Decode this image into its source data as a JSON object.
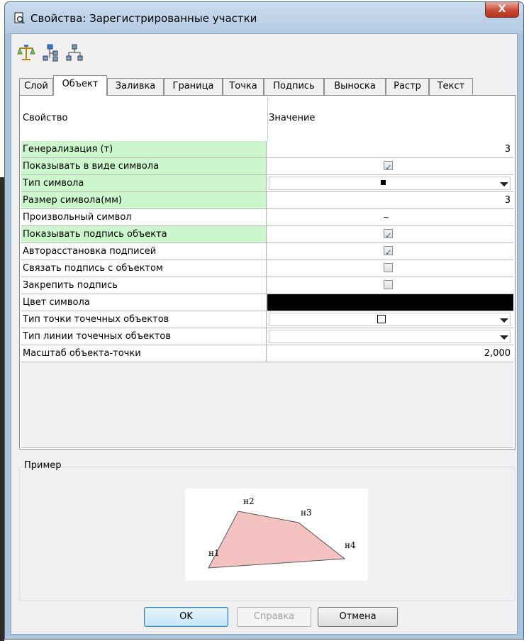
{
  "window": {
    "title": "Свойства: Зарегистрированные участки",
    "close_label": "X"
  },
  "toolbar": {
    "icons": [
      "scales-icon",
      "tree-expand-icon",
      "tree-structure-icon"
    ]
  },
  "tabs": [
    {
      "label": "Слой",
      "active": false
    },
    {
      "label": "Объект",
      "active": true
    },
    {
      "label": "Заливка",
      "active": false
    },
    {
      "label": "Граница",
      "active": false
    },
    {
      "label": "Точка",
      "active": false
    },
    {
      "label": "Подпись",
      "active": false
    },
    {
      "label": "Выноска",
      "active": false
    },
    {
      "label": "Растр",
      "active": false
    },
    {
      "label": "Текст",
      "active": false
    }
  ],
  "grid": {
    "header_property": "Свойство",
    "header_value": "Значение",
    "rows": [
      {
        "name": "Генерализация (т)",
        "highlight": true,
        "type": "number",
        "value": "3"
      },
      {
        "name": "Показывать в виде символа",
        "highlight": true,
        "type": "checkbox",
        "checked": true
      },
      {
        "name": "Тип символа",
        "highlight": true,
        "type": "combo-filled-square"
      },
      {
        "name": "Размер символа(мм)",
        "highlight": true,
        "type": "number",
        "value": "3"
      },
      {
        "name": "Произвольный символ",
        "highlight": false,
        "type": "tilde",
        "value": "~"
      },
      {
        "name": "Показывать подпись объекта",
        "highlight": true,
        "type": "checkbox",
        "checked": true
      },
      {
        "name": "Авторасстановка подписей",
        "highlight": false,
        "type": "checkbox",
        "checked": true
      },
      {
        "name": "Связать подпись с объектом",
        "highlight": false,
        "type": "checkbox",
        "checked": false
      },
      {
        "name": "Закрепить подпись",
        "highlight": false,
        "type": "checkbox",
        "checked": false
      },
      {
        "name": "Цвет символа",
        "highlight": false,
        "type": "color",
        "color": "#000000"
      },
      {
        "name": "Тип точки точечных объектов",
        "highlight": false,
        "type": "combo-empty-square"
      },
      {
        "name": "Тип линии точечных объектов",
        "highlight": false,
        "type": "combo-empty"
      },
      {
        "name": "Масштаб объекта-точки",
        "highlight": false,
        "type": "number",
        "value": "2,000"
      }
    ]
  },
  "example": {
    "label": "Пример",
    "points": [
      "н1",
      "н2",
      "н3",
      "н4"
    ],
    "fill_color": "#f5c2c2"
  },
  "buttons": {
    "ok": "OK",
    "help": "Справка",
    "cancel": "Отмена"
  },
  "colors": {
    "highlight_row": "#ccf7cc",
    "title_bar": "#b9cfe6",
    "close_button": "#c84a35"
  }
}
